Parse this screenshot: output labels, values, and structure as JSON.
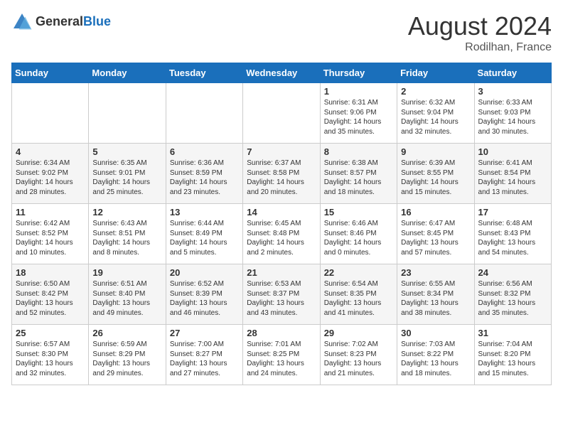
{
  "header": {
    "logo_general": "General",
    "logo_blue": "Blue",
    "month_year": "August 2024",
    "location": "Rodilhan, France"
  },
  "days_of_week": [
    "Sunday",
    "Monday",
    "Tuesday",
    "Wednesday",
    "Thursday",
    "Friday",
    "Saturday"
  ],
  "weeks": [
    [
      {
        "day": "",
        "content": ""
      },
      {
        "day": "",
        "content": ""
      },
      {
        "day": "",
        "content": ""
      },
      {
        "day": "",
        "content": ""
      },
      {
        "day": "1",
        "content": "Sunrise: 6:31 AM\nSunset: 9:06 PM\nDaylight: 14 hours and 35 minutes."
      },
      {
        "day": "2",
        "content": "Sunrise: 6:32 AM\nSunset: 9:04 PM\nDaylight: 14 hours and 32 minutes."
      },
      {
        "day": "3",
        "content": "Sunrise: 6:33 AM\nSunset: 9:03 PM\nDaylight: 14 hours and 30 minutes."
      }
    ],
    [
      {
        "day": "4",
        "content": "Sunrise: 6:34 AM\nSunset: 9:02 PM\nDaylight: 14 hours and 28 minutes."
      },
      {
        "day": "5",
        "content": "Sunrise: 6:35 AM\nSunset: 9:01 PM\nDaylight: 14 hours and 25 minutes."
      },
      {
        "day": "6",
        "content": "Sunrise: 6:36 AM\nSunset: 8:59 PM\nDaylight: 14 hours and 23 minutes."
      },
      {
        "day": "7",
        "content": "Sunrise: 6:37 AM\nSunset: 8:58 PM\nDaylight: 14 hours and 20 minutes."
      },
      {
        "day": "8",
        "content": "Sunrise: 6:38 AM\nSunset: 8:57 PM\nDaylight: 14 hours and 18 minutes."
      },
      {
        "day": "9",
        "content": "Sunrise: 6:39 AM\nSunset: 8:55 PM\nDaylight: 14 hours and 15 minutes."
      },
      {
        "day": "10",
        "content": "Sunrise: 6:41 AM\nSunset: 8:54 PM\nDaylight: 14 hours and 13 minutes."
      }
    ],
    [
      {
        "day": "11",
        "content": "Sunrise: 6:42 AM\nSunset: 8:52 PM\nDaylight: 14 hours and 10 minutes."
      },
      {
        "day": "12",
        "content": "Sunrise: 6:43 AM\nSunset: 8:51 PM\nDaylight: 14 hours and 8 minutes."
      },
      {
        "day": "13",
        "content": "Sunrise: 6:44 AM\nSunset: 8:49 PM\nDaylight: 14 hours and 5 minutes."
      },
      {
        "day": "14",
        "content": "Sunrise: 6:45 AM\nSunset: 8:48 PM\nDaylight: 14 hours and 2 minutes."
      },
      {
        "day": "15",
        "content": "Sunrise: 6:46 AM\nSunset: 8:46 PM\nDaylight: 14 hours and 0 minutes."
      },
      {
        "day": "16",
        "content": "Sunrise: 6:47 AM\nSunset: 8:45 PM\nDaylight: 13 hours and 57 minutes."
      },
      {
        "day": "17",
        "content": "Sunrise: 6:48 AM\nSunset: 8:43 PM\nDaylight: 13 hours and 54 minutes."
      }
    ],
    [
      {
        "day": "18",
        "content": "Sunrise: 6:50 AM\nSunset: 8:42 PM\nDaylight: 13 hours and 52 minutes."
      },
      {
        "day": "19",
        "content": "Sunrise: 6:51 AM\nSunset: 8:40 PM\nDaylight: 13 hours and 49 minutes."
      },
      {
        "day": "20",
        "content": "Sunrise: 6:52 AM\nSunset: 8:39 PM\nDaylight: 13 hours and 46 minutes."
      },
      {
        "day": "21",
        "content": "Sunrise: 6:53 AM\nSunset: 8:37 PM\nDaylight: 13 hours and 43 minutes."
      },
      {
        "day": "22",
        "content": "Sunrise: 6:54 AM\nSunset: 8:35 PM\nDaylight: 13 hours and 41 minutes."
      },
      {
        "day": "23",
        "content": "Sunrise: 6:55 AM\nSunset: 8:34 PM\nDaylight: 13 hours and 38 minutes."
      },
      {
        "day": "24",
        "content": "Sunrise: 6:56 AM\nSunset: 8:32 PM\nDaylight: 13 hours and 35 minutes."
      }
    ],
    [
      {
        "day": "25",
        "content": "Sunrise: 6:57 AM\nSunset: 8:30 PM\nDaylight: 13 hours and 32 minutes."
      },
      {
        "day": "26",
        "content": "Sunrise: 6:59 AM\nSunset: 8:29 PM\nDaylight: 13 hours and 29 minutes."
      },
      {
        "day": "27",
        "content": "Sunrise: 7:00 AM\nSunset: 8:27 PM\nDaylight: 13 hours and 27 minutes."
      },
      {
        "day": "28",
        "content": "Sunrise: 7:01 AM\nSunset: 8:25 PM\nDaylight: 13 hours and 24 minutes."
      },
      {
        "day": "29",
        "content": "Sunrise: 7:02 AM\nSunset: 8:23 PM\nDaylight: 13 hours and 21 minutes."
      },
      {
        "day": "30",
        "content": "Sunrise: 7:03 AM\nSunset: 8:22 PM\nDaylight: 13 hours and 18 minutes."
      },
      {
        "day": "31",
        "content": "Sunrise: 7:04 AM\nSunset: 8:20 PM\nDaylight: 13 hours and 15 minutes."
      }
    ]
  ]
}
